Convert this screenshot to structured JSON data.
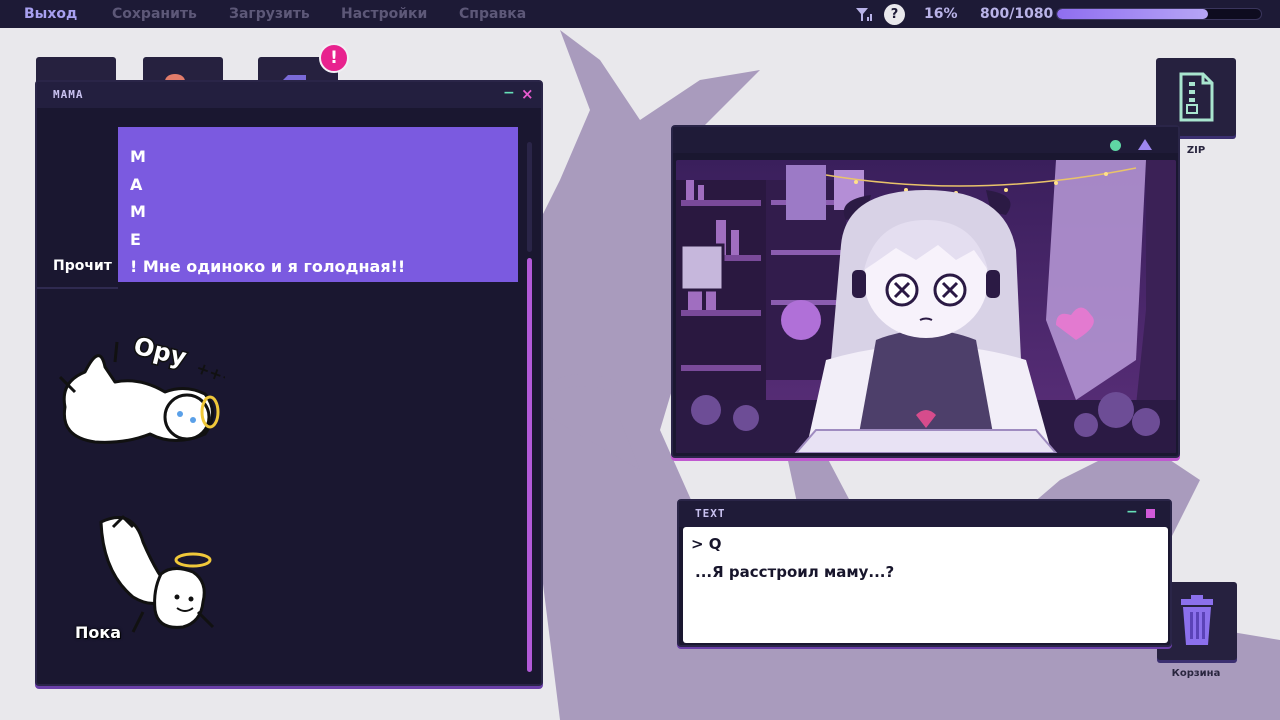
{
  "menu": {
    "exit": "Выход",
    "save": "Сохранить",
    "load": "Загрузить",
    "settings": "Настройки",
    "help": "Справка"
  },
  "status": {
    "help_symbol": "?",
    "battery": "16%",
    "followers": "800/1080",
    "followers_progress": 0.74,
    "signal_icon": "signal-icon"
  },
  "desktop": {
    "notification_badge": "!",
    "zip_label": "ZIP",
    "trash_label": "Корзина"
  },
  "chat_window": {
    "title": "МАМА",
    "minimize": "−",
    "close": "×",
    "message_lines": [
      "М",
      "А",
      "М",
      "Е",
      "! Мне одиноко и я голодная!!"
    ],
    "read_label": "Прочит",
    "stickers": [
      {
        "caption_art": "Ору",
        "icon": "laughing-angel-sticker"
      },
      {
        "caption": "Пока",
        "icon": "waving-angel-sticker"
      }
    ]
  },
  "video_window": {
    "scene": "streamer-room-scene"
  },
  "text_window": {
    "title": "TEXT",
    "minimize": "−",
    "prompt_line": "> Q",
    "response_line": "...Я расстроил маму...?"
  },
  "colors": {
    "topbar": "#1d1a36",
    "window_bg": "#1a1730",
    "accent_purple": "#7b5ae0",
    "badge_pink": "#e8228e",
    "progress": "#8f6ef0"
  }
}
